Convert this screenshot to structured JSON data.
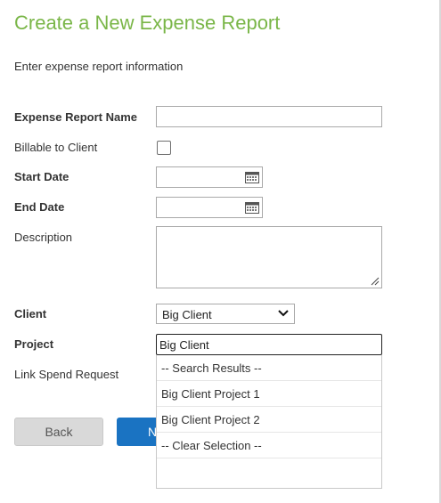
{
  "page": {
    "title": "Create a New Expense Report",
    "subtitle": "Enter expense report information"
  },
  "form": {
    "expense_report_name_label": "Expense Report Name",
    "expense_report_name_value": "",
    "billable_label": "Billable to Client",
    "billable_checked": false,
    "start_date_label": "Start Date",
    "start_date_value": "",
    "end_date_label": "End Date",
    "end_date_value": "",
    "description_label": "Description",
    "description_value": "",
    "client_label": "Client",
    "client_selected": "Big Client",
    "project_label": "Project",
    "project_input_value": "Big Client",
    "link_spend_request_label": "Link Spend Request"
  },
  "project_dropdown": {
    "items": [
      "-- Search Results --",
      "Big Client Project 1",
      "Big Client Project 2",
      "-- Clear Selection --"
    ]
  },
  "buttons": {
    "back_label": "Back",
    "next_label": "N"
  },
  "icons": {
    "calendar": "calendar-icon",
    "chevron": "chevron-down-icon",
    "resize": "resize-grip-icon"
  },
  "colors": {
    "title": "#7ab648",
    "primary_button": "#1a73c2",
    "secondary_button": "#d9d9d9"
  }
}
